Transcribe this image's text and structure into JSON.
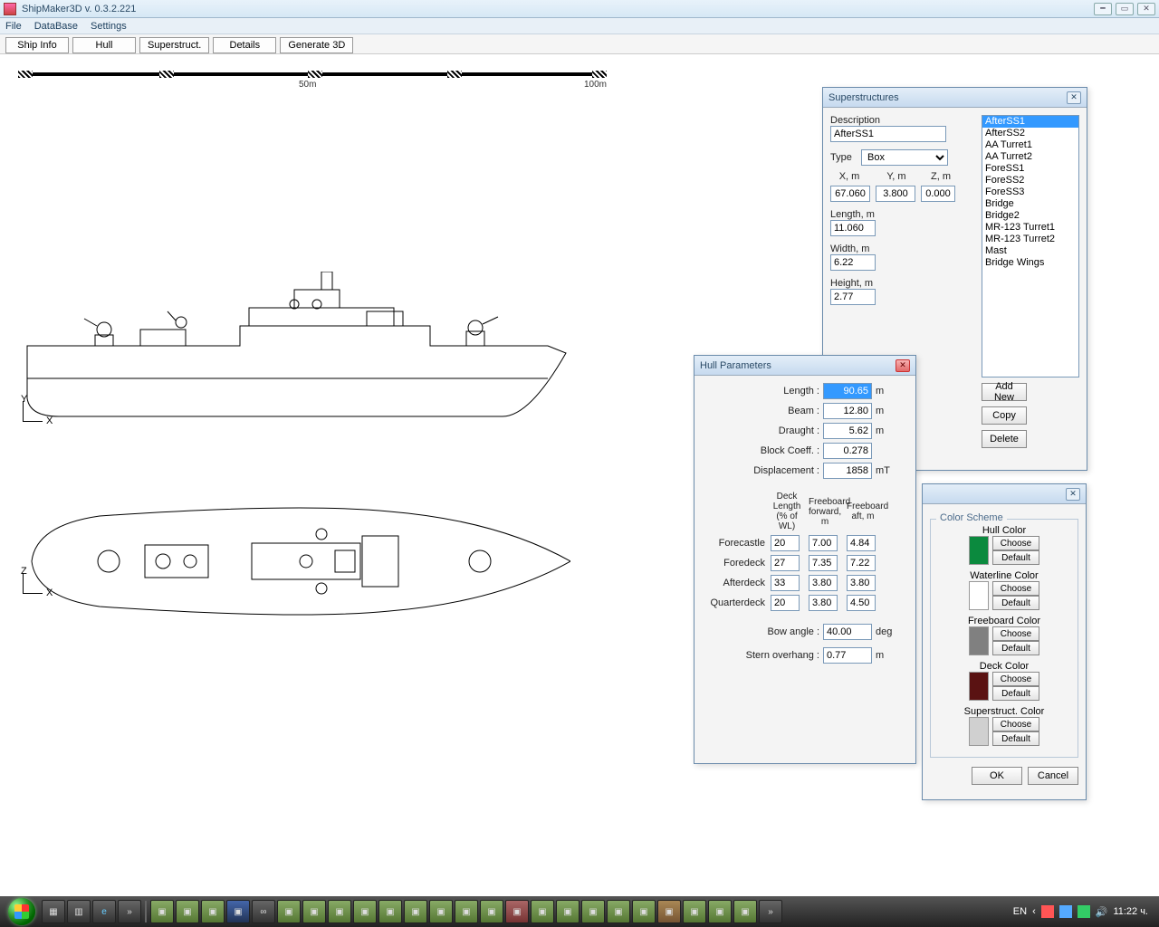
{
  "app": {
    "title": "ShipMaker3D v. 0.3.2.221"
  },
  "menubar": {
    "file": "File",
    "database": "DataBase",
    "settings": "Settings"
  },
  "tabs": {
    "ship_info": "Ship Info",
    "hull": "Hull",
    "superstruct": "Superstruct.",
    "details": "Details",
    "generate": "Generate 3D"
  },
  "ruler": {
    "mark50": "50m",
    "mark100": "100m"
  },
  "axes": {
    "side_y": "Y",
    "side_x": "X",
    "top_z": "Z",
    "top_x": "X"
  },
  "superstructures": {
    "title": "Superstructures",
    "description_lbl": "Description",
    "description_val": "AfterSS1",
    "type_lbl": "Type",
    "type_val": "Box",
    "x_lbl": "X, m",
    "y_lbl": "Y, m",
    "z_lbl": "Z, m",
    "x_val": "67.060",
    "y_val": "3.800",
    "z_val": "0.000",
    "length_lbl": "Length, m",
    "length_val": "11.060",
    "width_lbl": "Width, m",
    "width_val": "6.22",
    "height_lbl": "Height, m",
    "height_val": "2.77",
    "list": [
      "AfterSS1",
      "AfterSS2",
      "AA Turret1",
      "AA Turret2",
      "ForeSS1",
      "ForeSS2",
      "ForeSS3",
      "Bridge",
      "Bridge2",
      "MR-123 Turret1",
      "MR-123 Turret2",
      "Mast",
      "Bridge Wings"
    ],
    "addnew": "Add New",
    "copy": "Copy",
    "delete": "Delete"
  },
  "hull": {
    "title": "Hull Parameters",
    "length_lbl": "Length :",
    "length_val": "90.65",
    "length_unit": "m",
    "beam_lbl": "Beam :",
    "beam_val": "12.80",
    "beam_unit": "m",
    "draught_lbl": "Draught :",
    "draught_val": "5.62",
    "draught_unit": "m",
    "block_lbl": "Block Coeff. :",
    "block_val": "0.278",
    "disp_lbl": "Displacement :",
    "disp_val": "1858",
    "disp_unit": "mT",
    "hdr_deck": "Deck Length (% of WL)",
    "hdr_fwd": "Freeboard forward, m",
    "hdr_aft": "Freeboard aft, m",
    "forecastle_lbl": "Forecastle",
    "forecastle_pct": "20",
    "forecastle_fwd": "7.00",
    "forecastle_aft": "4.84",
    "foredeck_lbl": "Foredeck",
    "foredeck_pct": "27",
    "foredeck_fwd": "7.35",
    "foredeck_aft": "7.22",
    "afterdeck_lbl": "Afterdeck",
    "afterdeck_pct": "33",
    "afterdeck_fwd": "3.80",
    "afterdeck_aft": "3.80",
    "quarterdeck_lbl": "Quarterdeck",
    "quarterdeck_pct": "20",
    "quarterdeck_fwd": "3.80",
    "quarterdeck_aft": "4.50",
    "bow_lbl": "Bow angle :",
    "bow_val": "40.00",
    "bow_unit": "deg",
    "stern_lbl": "Stern overhang :",
    "stern_val": "0.77",
    "stern_unit": "m"
  },
  "colorscheme": {
    "title": "Color Scheme",
    "hull_lbl": "Hull Color",
    "hull_color": "#0b8a3e",
    "waterline_lbl": "Waterline Color",
    "waterline_color": "#ffffff",
    "freeboard_lbl": "Freeboard Color",
    "freeboard_color": "#808080",
    "deck_lbl": "Deck Color",
    "deck_color": "#5a1212",
    "super_lbl": "Superstruct. Color",
    "super_color": "#d0d0d0",
    "choose": "Choose",
    "default": "Default",
    "ok": "OK",
    "cancel": "Cancel"
  },
  "taskbar": {
    "lang": "EN",
    "clock": "11:22 ч."
  }
}
